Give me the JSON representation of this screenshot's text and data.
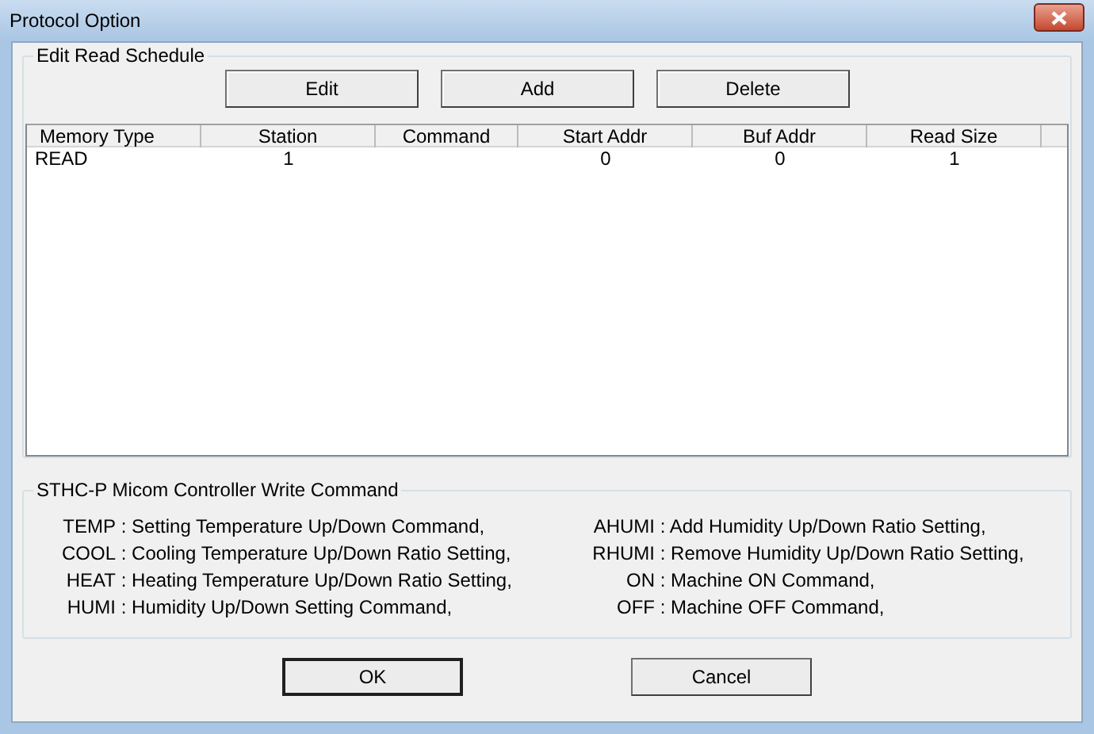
{
  "window": {
    "title": "Protocol Option"
  },
  "schedule": {
    "legend": "Edit Read Schedule",
    "buttons": [
      "Edit",
      "Add",
      "Delete"
    ],
    "columns": [
      "Memory Type",
      "Station",
      "Command",
      "Start Addr",
      "Buf Addr",
      "Read Size"
    ],
    "rows": [
      [
        "READ",
        "1",
        "",
        "0",
        "0",
        "1"
      ]
    ]
  },
  "commands": {
    "legend": "STHC-P Micom Controller Write Command",
    "separator": ":",
    "items": [
      {
        "code": "TEMP",
        "text": "Setting Temperature Up/Down Command,"
      },
      {
        "code": "AHUMI",
        "text": "Add Humidity Up/Down Ratio Setting,"
      },
      {
        "code": "COOL",
        "text": "Cooling Temperature Up/Down Ratio Setting,"
      },
      {
        "code": "RHUMI",
        "text": "Remove Humidity Up/Down Ratio Setting,"
      },
      {
        "code": "HEAT",
        "text": "Heating Temperature Up/Down Ratio Setting,"
      },
      {
        "code": "ON",
        "text": "Machine ON Command,"
      },
      {
        "code": "HUMI",
        "text": "Humidity Up/Down Setting Command,"
      },
      {
        "code": "OFF",
        "text": "Machine OFF Command,"
      }
    ]
  },
  "buttons": [
    {
      "label": "OK",
      "default": true
    },
    {
      "label": "Cancel",
      "default": false
    }
  ]
}
